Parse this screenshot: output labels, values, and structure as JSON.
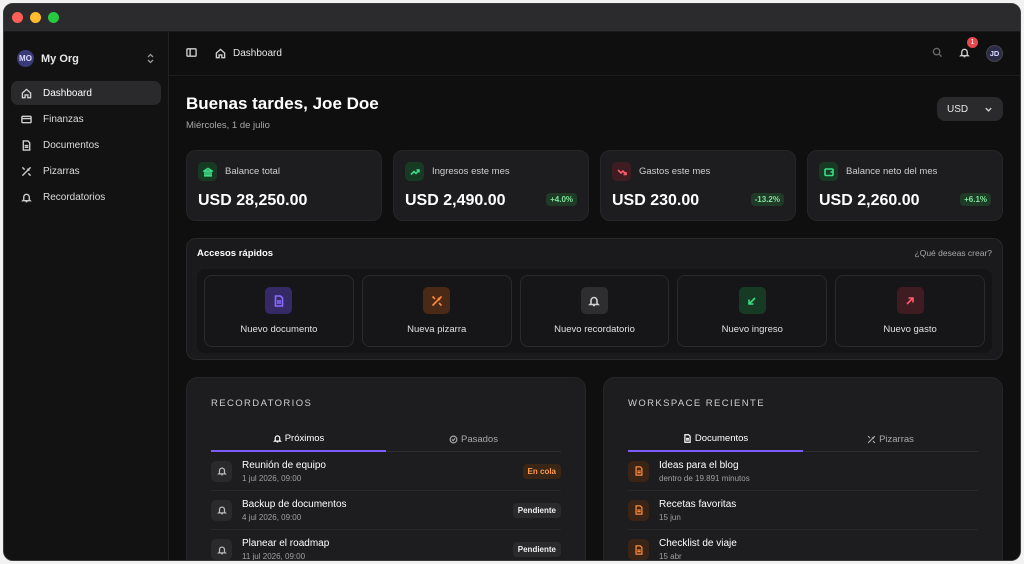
{
  "org": {
    "initials": "MO",
    "name": "My Org"
  },
  "sidebar": {
    "items": [
      {
        "label": "Dashboard",
        "icon": "home-icon",
        "active": true
      },
      {
        "label": "Finanzas",
        "icon": "card-icon"
      },
      {
        "label": "Documentos",
        "icon": "file-icon"
      },
      {
        "label": "Pizarras",
        "icon": "pencil-ruler-icon"
      },
      {
        "label": "Recordatorios",
        "icon": "bell-icon"
      }
    ]
  },
  "topbar": {
    "breadcrumb": "Dashboard",
    "notifications": "1",
    "user_initials": "JD"
  },
  "header": {
    "greeting": "Buenas tardes, Joe Doe",
    "date": "Miércoles, 1 de julio",
    "currency": "USD"
  },
  "stats": [
    {
      "label": "Balance total",
      "value": "USD 28,250.00",
      "delta": "",
      "color": "#3ddc84"
    },
    {
      "label": "Ingresos este mes",
      "value": "USD 2,490.00",
      "delta": "+4.0%",
      "color": "#3ddc84"
    },
    {
      "label": "Gastos este mes",
      "value": "USD 230.00",
      "delta": "-13.2%",
      "color": "#ff5a6a"
    },
    {
      "label": "Balance neto del mes",
      "value": "USD 2,260.00",
      "delta": "+6.1%",
      "color": "#3ddc84"
    }
  ],
  "quick": {
    "title": "Accesos rápidos",
    "hint": "¿Qué deseas crear?",
    "actions": [
      {
        "label": "Nuevo documento",
        "color": "#8b6cff",
        "bg": "#352a66"
      },
      {
        "label": "Nueva pizarra",
        "color": "#ff8a3d",
        "bg": "#4a2a16"
      },
      {
        "label": "Nuevo recordatorio",
        "color": "#cfcfcf",
        "bg": "#2e2e30"
      },
      {
        "label": "Nuevo ingreso",
        "color": "#3ddc84",
        "bg": "#173a25"
      },
      {
        "label": "Nuevo gasto",
        "color": "#ff5a6a",
        "bg": "#3f1c22"
      }
    ]
  },
  "reminders": {
    "title": "RECORDATORIOS",
    "tabs": [
      "Próximos",
      "Pasados"
    ],
    "items": [
      {
        "title": "Reunión de equipo",
        "sub": "1 jul 2026, 09:00",
        "status": "En cola",
        "kind": "queue"
      },
      {
        "title": "Backup de documentos",
        "sub": "4 jul 2026, 09:00",
        "status": "Pendiente",
        "kind": "pending"
      },
      {
        "title": "Planear el roadmap",
        "sub": "11 jul 2026, 09:00",
        "status": "Pendiente",
        "kind": "pending"
      }
    ]
  },
  "workspace": {
    "title": "WORKSPACE RECIENTE",
    "tabs": [
      "Documentos",
      "Pizarras"
    ],
    "items": [
      {
        "title": "Ideas para el blog",
        "sub": "dentro de 19.891 minutos"
      },
      {
        "title": "Recetas favoritas",
        "sub": "15 jun"
      },
      {
        "title": "Checklist de viaje",
        "sub": "15 abr"
      }
    ]
  }
}
